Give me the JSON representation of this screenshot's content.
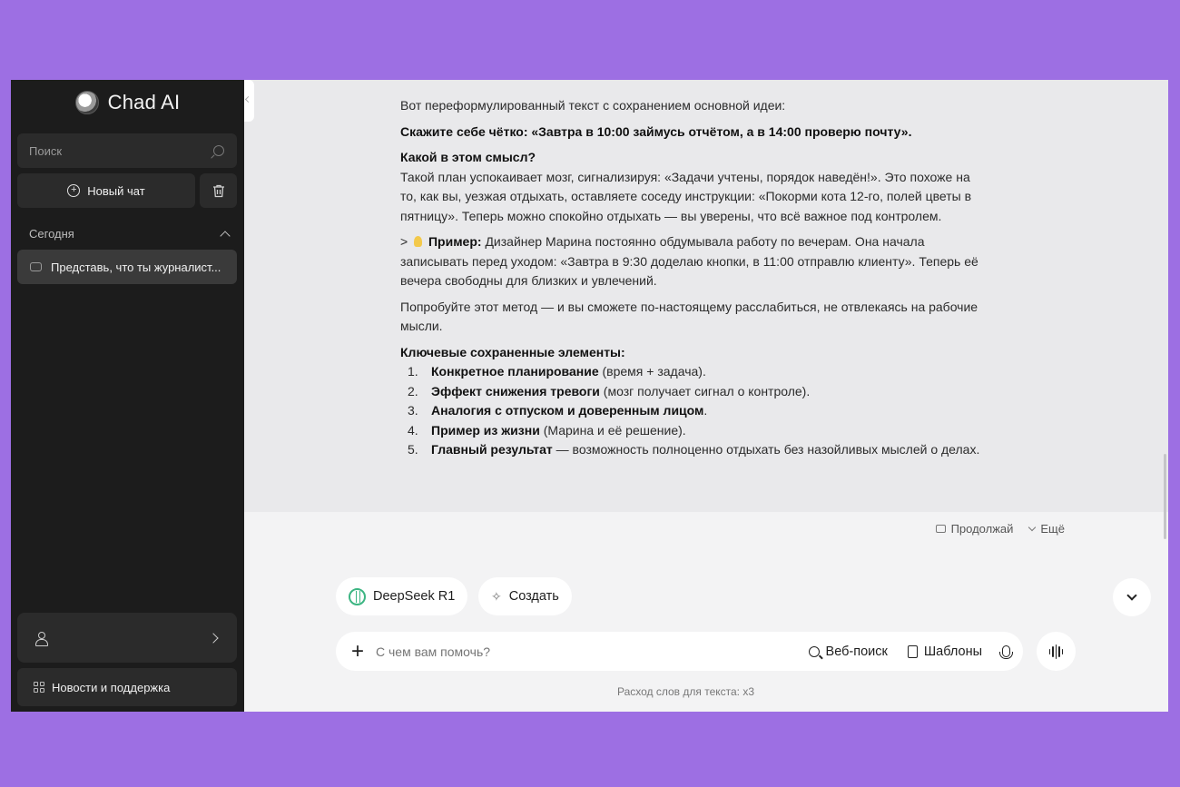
{
  "sidebar": {
    "brand": "Chad AI",
    "search_placeholder": "Поиск",
    "new_chat": "Новый чат",
    "section_today": "Сегодня",
    "chat_item": "Представь, что ты журналист...",
    "news_support": "Новости и поддержка"
  },
  "answer": {
    "intro": "Вот переформулированный текст с сохранением основной идеи:",
    "bold_statement": "Скажите себе чётко: «Завтра в 10:00 займусь отчётом, а в 14:00 проверю почту».",
    "meaning_title": "Какой в этом смысл?",
    "meaning_text": "Такой план успокаивает мозг, сигнализируя: «Задачи учтены, порядок наведён!». Это похоже на то, как вы, уезжая отдыхать, оставляете соседу инструкции: «Покорми кота 12-го, полей цветы в пятницу». Теперь можно спокойно отдыхать — вы уверены, что всё важное под контролем.",
    "example_prefix": ">",
    "example_label": "Пример:",
    "example_text": "Дизайнер Марина постоянно обдумывала работу по вечерам. Она начала записывать перед уходом: «Завтра в 9:30 доделаю кнопки, в 11:00 отправлю клиенту». Теперь её вечера свободны для близких и увлечений.",
    "try_text": "Попробуйте этот метод — и вы сможете по-настоящему расслабиться, не отвлекаясь на рабочие мысли.",
    "key_title": "Ключевые сохраненные элементы:",
    "key_items": [
      {
        "num": "1.",
        "bold": "Конкретное планирование",
        "rest": " (время + задача)."
      },
      {
        "num": "2.",
        "bold": "Эффект снижения тревоги",
        "rest": " (мозг получает сигнал о контроле)."
      },
      {
        "num": "3.",
        "bold": "Аналогия с отпуском и доверенным лицом",
        "rest": "."
      },
      {
        "num": "4.",
        "bold": "Пример из жизни",
        "rest": " (Марина и её решение)."
      },
      {
        "num": "5.",
        "bold": "Главный результат",
        "rest": " — возможность полноценно отдыхать без назойливых мыслей о делах."
      }
    ]
  },
  "actions": {
    "continue": "Продолжай",
    "more": "Ещё"
  },
  "model": {
    "name": "DeepSeek R1",
    "create": "Создать"
  },
  "composer": {
    "placeholder": "С чем вам помочь?",
    "web_search": "Веб-поиск",
    "templates": "Шаблоны"
  },
  "footer_note": "Расход слов для текста: x3",
  "colors": {
    "page_bg": "#9d6fe3",
    "sidebar_bg": "#1c1c1c",
    "accent_green": "#3cb582"
  }
}
